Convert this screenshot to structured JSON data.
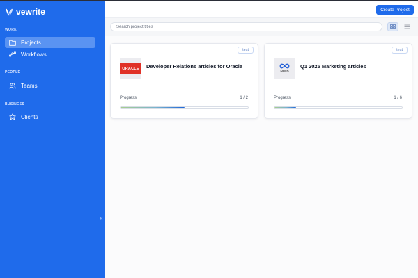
{
  "app": {
    "name": "vewrite",
    "logo_icon": "v-logo-icon"
  },
  "sidebar": {
    "sections": [
      {
        "label": "WORK"
      },
      {
        "label": "PEOPLE"
      },
      {
        "label": "BUSINESS"
      }
    ],
    "items": [
      {
        "label": "Projects",
        "icon": "folder-icon",
        "active": true
      },
      {
        "label": "Workflows",
        "icon": "workflow-icon",
        "active": false
      },
      {
        "label": "Teams",
        "icon": "users-icon",
        "active": false
      },
      {
        "label": "Clients",
        "icon": "star-icon",
        "active": false
      }
    ],
    "collapse_glyph": "«"
  },
  "header": {
    "create_label": "Create Project"
  },
  "search": {
    "placeholder": "Search project titles",
    "value": ""
  },
  "view_toggle": {
    "selected": "grid"
  },
  "projects": [
    {
      "tag": "test",
      "title": "Developer Relations articles for Oracle",
      "client_logo_text": "ORACLE",
      "progress_label": "Progress",
      "progress_text": "1 / 2",
      "progress": 0.5
    },
    {
      "tag": "test",
      "title": "Q1 2025 Marketing articles",
      "client_logo_text": "Meto",
      "progress_label": "Progress",
      "progress_text": "1 / 6",
      "progress": 0.1667
    }
  ],
  "colors": {
    "brand": "#1f6beb",
    "oracle_red": "#e03127"
  }
}
